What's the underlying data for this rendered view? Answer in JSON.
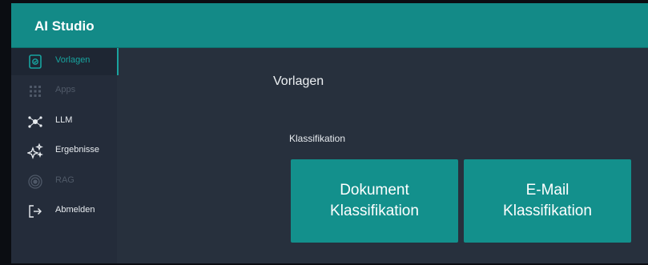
{
  "app": {
    "title": "AI Studio"
  },
  "sidebar": {
    "items": [
      {
        "label": "Vorlagen",
        "icon": "template-icon",
        "state": "active"
      },
      {
        "label": "Apps",
        "icon": "apps-grid-icon",
        "state": "disabled"
      },
      {
        "label": "LLM",
        "icon": "llm-network-icon",
        "state": "normal"
      },
      {
        "label": "Ergebnisse",
        "icon": "sparkles-icon",
        "state": "normal"
      },
      {
        "label": "RAG",
        "icon": "rag-target-icon",
        "state": "disabled"
      },
      {
        "label": "Abmelden",
        "icon": "logout-icon",
        "state": "normal"
      }
    ]
  },
  "main": {
    "title": "Vorlagen",
    "section": "Klassifikation",
    "tiles": [
      {
        "line1": "Dokument",
        "line2": "Klassifikation"
      },
      {
        "line1": "E-Mail",
        "line2": "Klassifikation"
      }
    ]
  },
  "colors": {
    "accent": "#138a87",
    "tile": "#13908c",
    "background": "#27303d",
    "sidebar": "#242c3a"
  }
}
